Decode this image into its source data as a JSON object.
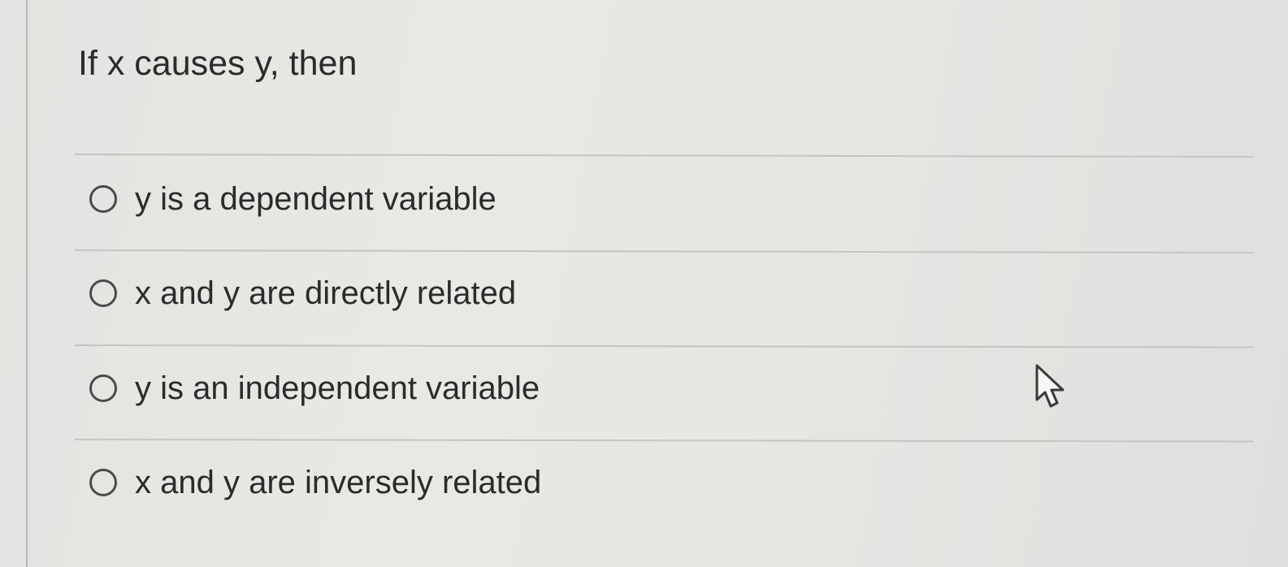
{
  "question": {
    "text": "If x causes y, then"
  },
  "answers": [
    {
      "label": "y is a dependent variable",
      "selected": false
    },
    {
      "label": "x and y are directly related",
      "selected": false
    },
    {
      "label": "y is an independent variable",
      "selected": false
    },
    {
      "label": "x and y are inversely related",
      "selected": false
    }
  ],
  "cursor": {
    "icon": "arrow-pointer-icon"
  }
}
